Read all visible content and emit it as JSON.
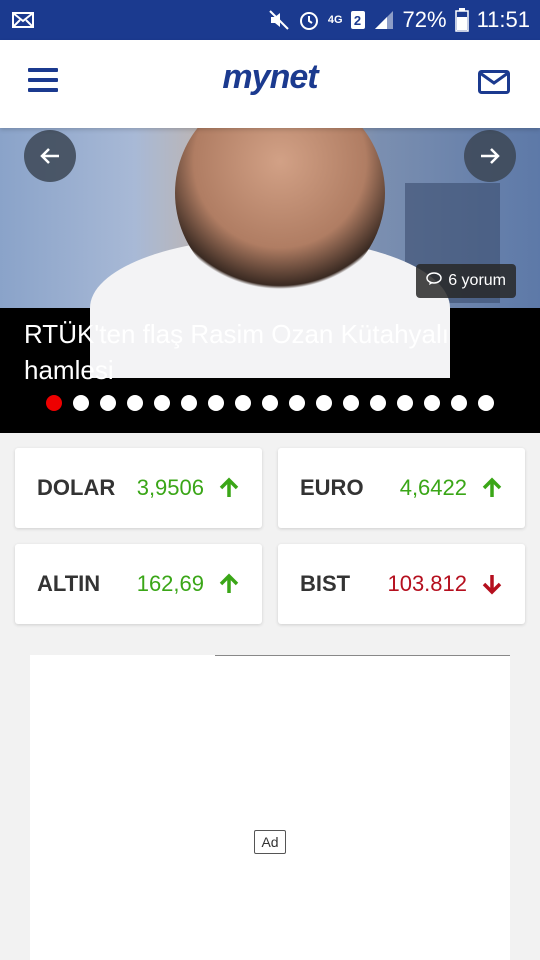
{
  "status_bar": {
    "battery": "72%",
    "time": "11:51",
    "network": "4G",
    "sim": "2",
    "icons": [
      "mail-icon",
      "mute-icon",
      "alarm-icon",
      "signal-icon",
      "battery-icon"
    ]
  },
  "header": {
    "logo": "mynet",
    "menu_icon": "hamburger-icon",
    "mail_icon": "envelope-icon"
  },
  "slider": {
    "headline": "RTÜK'ten flaş Rasim Ozan Kütahyalı hamlesi",
    "comments": "6 yorum",
    "dot_count": 17,
    "active_dot": 0
  },
  "markets": [
    {
      "name": "DOLAR",
      "value": "3,9506",
      "trend": "up"
    },
    {
      "name": "EURO",
      "value": "4,6422",
      "trend": "up"
    },
    {
      "name": "ALTIN",
      "value": "162,69",
      "trend": "up"
    },
    {
      "name": "BIST",
      "value": "103.812",
      "trend": "down"
    }
  ],
  "ad": {
    "label": "Ad"
  },
  "colors": {
    "brand": "#1b3a8f",
    "accent": "#ee0000",
    "up": "#3aa617",
    "down": "#b50f1e"
  }
}
